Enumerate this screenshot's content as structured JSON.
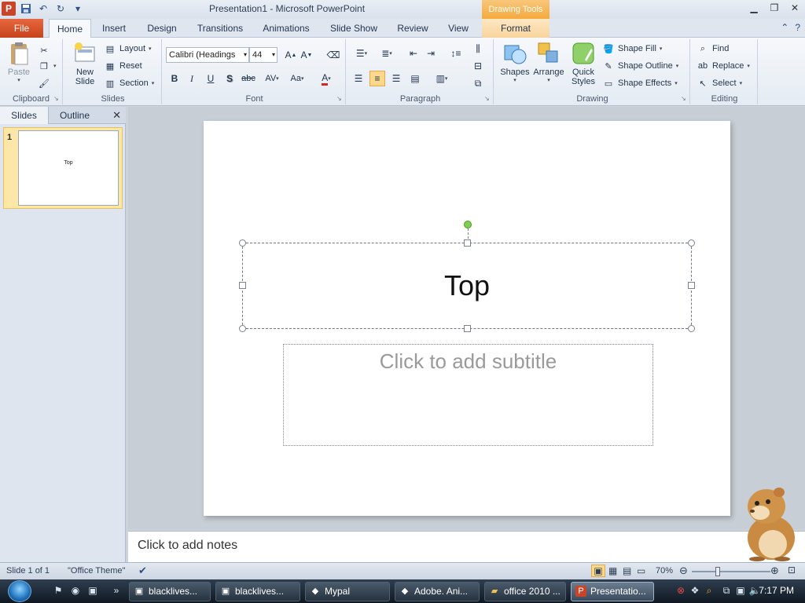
{
  "window": {
    "title": "Presentation1  -  Microsoft PowerPoint",
    "contextual_header": "Drawing Tools"
  },
  "tabs": [
    {
      "label": "File"
    },
    {
      "label": "Home"
    },
    {
      "label": "Insert"
    },
    {
      "label": "Design"
    },
    {
      "label": "Transitions"
    },
    {
      "label": "Animations"
    },
    {
      "label": "Slide Show"
    },
    {
      "label": "Review"
    },
    {
      "label": "View"
    },
    {
      "label": "Format"
    }
  ],
  "ribbon": {
    "clipboard": {
      "label": "Clipboard",
      "paste": "Paste"
    },
    "slides": {
      "label": "Slides",
      "new_slide_1": "New",
      "new_slide_2": "Slide",
      "layout": "Layout",
      "reset": "Reset",
      "section": "Section"
    },
    "font": {
      "label": "Font",
      "font_name": "Calibri (Headings",
      "font_size": "44",
      "bold": "B",
      "italic": "I",
      "underline": "U",
      "shadow": "S",
      "strike": "abc",
      "spacing": "AV",
      "case": "Aa"
    },
    "paragraph": {
      "label": "Paragraph"
    },
    "drawing": {
      "label": "Drawing",
      "shapes": "Shapes",
      "arrange": "Arrange",
      "quick_styles_1": "Quick",
      "quick_styles_2": "Styles",
      "shape_fill": "Shape Fill",
      "shape_outline": "Shape Outline",
      "shape_effects": "Shape Effects"
    },
    "editing": {
      "label": "Editing",
      "find": "Find",
      "replace": "Replace",
      "select": "Select"
    }
  },
  "left_pane": {
    "tabs": [
      "Slides",
      "Outline"
    ],
    "thumbnails": [
      {
        "number": "1",
        "title": "Top"
      }
    ]
  },
  "slide": {
    "title": "Top",
    "subtitle_placeholder": "Click to add subtitle"
  },
  "notes": {
    "placeholder": "Click to add notes"
  },
  "statusbar": {
    "slide_info": "Slide 1 of 1",
    "theme": "\"Office Theme\"",
    "zoom": "70%"
  },
  "taskbar": {
    "items": [
      {
        "label": "blacklives..."
      },
      {
        "label": "blacklives..."
      },
      {
        "label": "Mypal"
      },
      {
        "label": "Adobe. Ani..."
      },
      {
        "label": "office 2010 ..."
      },
      {
        "label": "Presentatio..."
      }
    ],
    "clock": "7:17 PM"
  }
}
